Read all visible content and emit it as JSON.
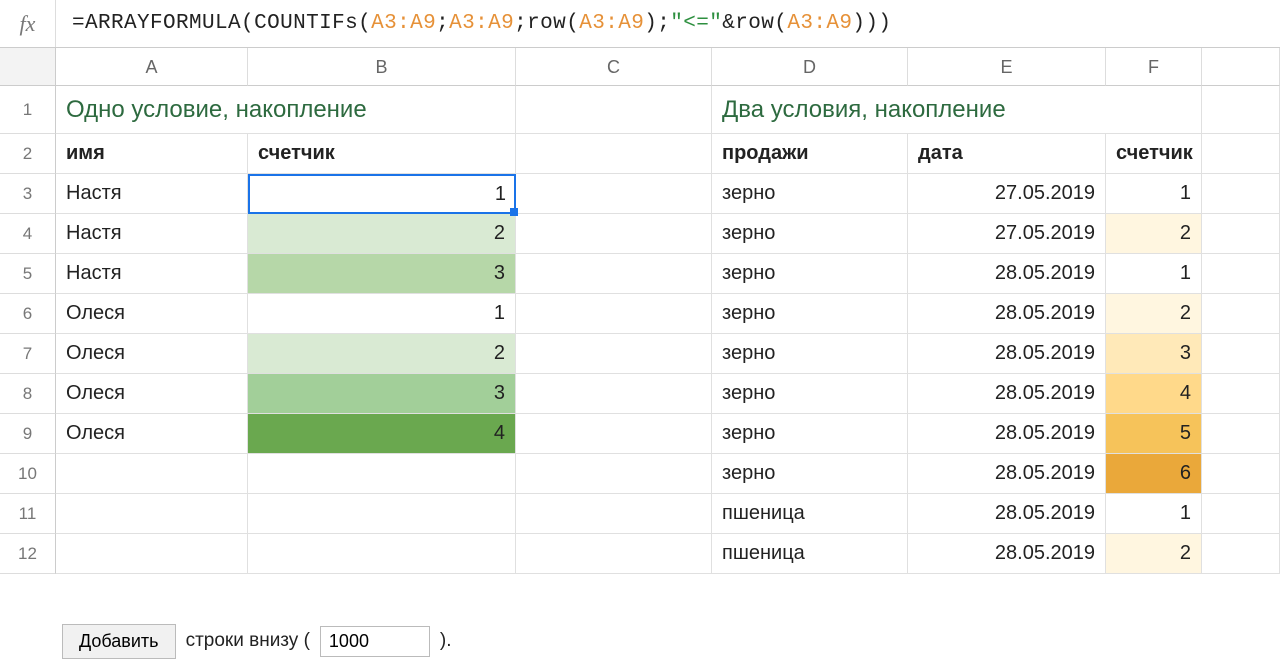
{
  "formula_bar": {
    "fx": "fx",
    "tokens": [
      {
        "t": "=",
        "c": "black"
      },
      {
        "t": "ARRAYFORMULA",
        "c": "black"
      },
      {
        "t": "(",
        "c": "black"
      },
      {
        "t": "COUNTIFs",
        "c": "black"
      },
      {
        "t": "(",
        "c": "black"
      },
      {
        "t": "A3:A9",
        "c": "orange"
      },
      {
        "t": ";",
        "c": "black"
      },
      {
        "t": "A3:A9",
        "c": "orange"
      },
      {
        "t": ";",
        "c": "black"
      },
      {
        "t": "row",
        "c": "black"
      },
      {
        "t": "(",
        "c": "black"
      },
      {
        "t": "A3:A9",
        "c": "orange"
      },
      {
        "t": ")",
        "c": "black"
      },
      {
        "t": ";",
        "c": "black"
      },
      {
        "t": "\"<=\"",
        "c": "green"
      },
      {
        "t": "&",
        "c": "black"
      },
      {
        "t": "row",
        "c": "black"
      },
      {
        "t": "(",
        "c": "black"
      },
      {
        "t": "A3:A9",
        "c": "orange"
      },
      {
        "t": ")",
        "c": "black"
      },
      {
        "t": ")",
        "c": "black"
      },
      {
        "t": ")",
        "c": "black"
      }
    ]
  },
  "columns": [
    "A",
    "B",
    "C",
    "D",
    "E",
    "F"
  ],
  "rows": [
    "1",
    "2",
    "3",
    "4",
    "5",
    "6",
    "7",
    "8",
    "9",
    "10",
    "11",
    "12"
  ],
  "titleLeft": "Одно условие, накопление",
  "titleRight": "Два условия, накопление",
  "headersLeft": {
    "name": "имя",
    "counter": "счетчик"
  },
  "headersRight": {
    "sales": "продажи",
    "date": "дата",
    "counter": "счетчик"
  },
  "left": [
    {
      "name": "Настя",
      "counter": 1,
      "shade": "g1"
    },
    {
      "name": "Настя",
      "counter": 2,
      "shade": "g2"
    },
    {
      "name": "Настя",
      "counter": 3,
      "shade": "g3"
    },
    {
      "name": "Олеся",
      "counter": 1,
      "shade": "g1"
    },
    {
      "name": "Олеся",
      "counter": 2,
      "shade": "g2"
    },
    {
      "name": "Олеся",
      "counter": 3,
      "shade": "g4"
    },
    {
      "name": "Олеся",
      "counter": 4,
      "shade": "g6"
    }
  ],
  "right": [
    {
      "sales": "зерно",
      "date": "27.05.2019",
      "counter": 1,
      "shade": "y1"
    },
    {
      "sales": "зерно",
      "date": "27.05.2019",
      "counter": 2,
      "shade": "y2"
    },
    {
      "sales": "зерно",
      "date": "28.05.2019",
      "counter": 1,
      "shade": "y1"
    },
    {
      "sales": "зерно",
      "date": "28.05.2019",
      "counter": 2,
      "shade": "y2"
    },
    {
      "sales": "зерно",
      "date": "28.05.2019",
      "counter": 3,
      "shade": "y3"
    },
    {
      "sales": "зерно",
      "date": "28.05.2019",
      "counter": 4,
      "shade": "y4"
    },
    {
      "sales": "зерно",
      "date": "28.05.2019",
      "counter": 5,
      "shade": "y5"
    },
    {
      "sales": "зерно",
      "date": "28.05.2019",
      "counter": 6,
      "shade": "y6"
    },
    {
      "sales": "пшеница",
      "date": "28.05.2019",
      "counter": 1,
      "shade": "y1"
    },
    {
      "sales": "пшеница",
      "date": "28.05.2019",
      "counter": 2,
      "shade": "y2"
    }
  ],
  "footer": {
    "add": "Добавить",
    "rows_text": "строки внизу (",
    "rows_value": "1000",
    "closing": ")."
  }
}
